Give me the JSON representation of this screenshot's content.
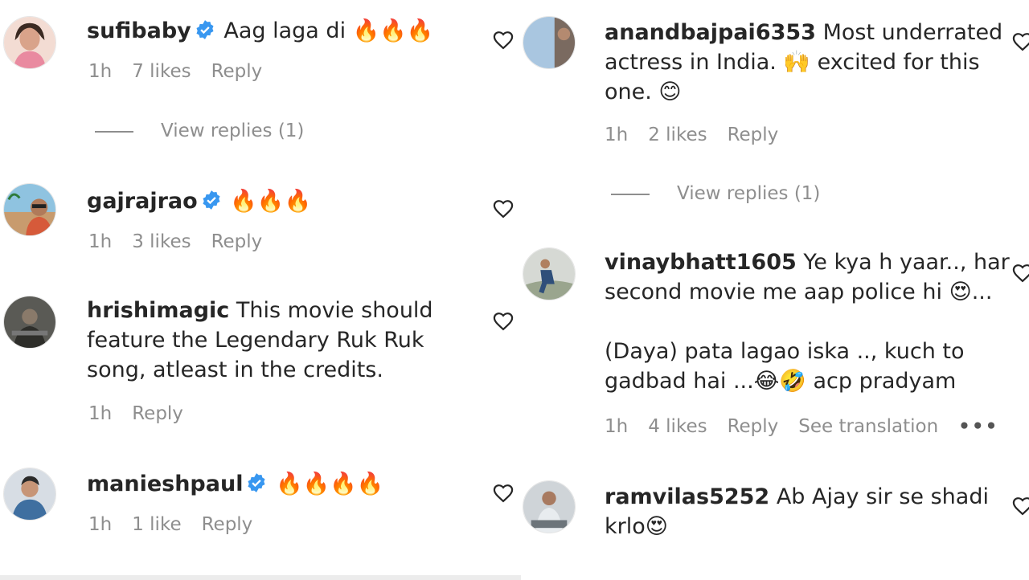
{
  "left_column": {
    "comments": [
      {
        "username": "sufibaby",
        "verified": true,
        "text": "Aag laga di 🔥🔥🔥",
        "time": "1h",
        "likes": "7 likes",
        "reply_label": "Reply",
        "view_replies": "View replies (1)"
      },
      {
        "username": "gajrajrao",
        "verified": true,
        "text": "🔥🔥🔥",
        "time": "1h",
        "likes": "3 likes",
        "reply_label": "Reply"
      },
      {
        "username": "hrishimagic",
        "verified": false,
        "text": "This movie should feature the Legendary Ruk Ruk song, atleast in the credits.",
        "time": "1h",
        "reply_label": "Reply"
      },
      {
        "username": "manieshpaul",
        "verified": true,
        "text": "🔥🔥🔥🔥",
        "time": "1h",
        "likes": "1 like",
        "reply_label": "Reply"
      }
    ]
  },
  "right_column": {
    "comments": [
      {
        "username": "anandbajpai6353",
        "text_line1": "Most underrated",
        "text_line2": "actress in India. 🙌 excited for this",
        "text_line3": "one. 😊",
        "time": "1h",
        "likes": "2 likes",
        "reply_label": "Reply",
        "view_replies": "View replies (1)"
      },
      {
        "username": "vinaybhatt1605",
        "text_line1": "Ye kya h yaar.., har",
        "text_line2": "second movie me aap police hi 😍...",
        "text_line3": "(Daya) pata lagao iska .., kuch to",
        "text_line4": "gadbad hai ...😂🤣 acp pradyam",
        "time": "1h",
        "likes": "4 likes",
        "reply_label": "Reply",
        "translate_label": "See translation",
        "more_label": "•••"
      },
      {
        "username": "ramvilas5252",
        "text_line1": "Ab Ajay sir se shadi",
        "text_line2": "krlo😍"
      }
    ]
  },
  "colors": {
    "text": "#262626",
    "secondary": "#8e8e8e",
    "verified_blue": "#3897f0"
  }
}
